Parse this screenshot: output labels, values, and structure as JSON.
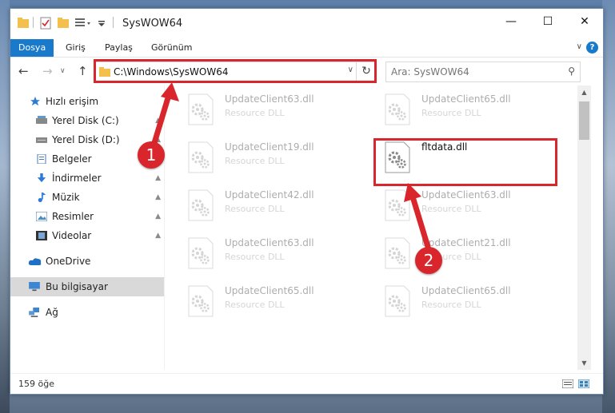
{
  "window": {
    "title": "SysWOW64",
    "controls": {
      "minimize": "—",
      "maximize": "☐",
      "close": "✕"
    }
  },
  "ribbon": {
    "tabs": [
      {
        "label": "Dosya",
        "active": true
      },
      {
        "label": "Giriş"
      },
      {
        "label": "Paylaş"
      },
      {
        "label": "Görünüm"
      }
    ],
    "help": "?"
  },
  "nav": {
    "back_icon": "arrow-left-icon",
    "forward_icon": "arrow-right-icon",
    "up_icon": "arrow-up-icon",
    "address_path": "C:\\Windows\\SysWOW64",
    "search_placeholder": "Ara: SysWOW64"
  },
  "sidebar": {
    "items": [
      {
        "label": "Hızlı erişim",
        "icon": "star-icon",
        "pinned": false
      },
      {
        "label": "Yerel Disk (C:)",
        "icon": "drive-icon",
        "pinned": true
      },
      {
        "label": "Yerel Disk (D:)",
        "icon": "drive-icon",
        "pinned": true
      },
      {
        "label": "Belgeler",
        "icon": "documents-icon",
        "pinned": true
      },
      {
        "label": "İndirmeler",
        "icon": "download-icon",
        "pinned": true
      },
      {
        "label": "Müzik",
        "icon": "music-icon",
        "pinned": true
      },
      {
        "label": "Resimler",
        "icon": "pictures-icon",
        "pinned": true
      },
      {
        "label": "Videolar",
        "icon": "videos-icon",
        "pinned": true
      },
      {
        "label": "OneDrive",
        "icon": "cloud-icon",
        "pinned": false
      },
      {
        "label": "Bu bilgisayar",
        "icon": "computer-icon",
        "pinned": false,
        "selected": true
      },
      {
        "label": "Ağ",
        "icon": "network-icon",
        "pinned": false
      }
    ]
  },
  "files": [
    {
      "name": "UpdateClient63.dll",
      "type": "Resource DLL",
      "faded": true
    },
    {
      "name": "UpdateClient65.dll",
      "type": "Resource DLL",
      "faded": true
    },
    {
      "name": "UpdateClient19.dll",
      "type": "Resource DLL",
      "faded": true
    },
    {
      "name": "fltdata.dll",
      "type": "",
      "faded": false
    },
    {
      "name": "UpdateClient42.dll",
      "type": "Resource DLL",
      "faded": true
    },
    {
      "name": "UpdateClient63.dll",
      "type": "Resource DLL",
      "faded": true
    },
    {
      "name": "UpdateClient63.dll",
      "type": "Resource DLL",
      "faded": true
    },
    {
      "name": "UpdateClient21.dll",
      "type": "Resource DLL",
      "faded": true
    },
    {
      "name": "UpdateClient65.dll",
      "type": "Resource DLL",
      "faded": true
    },
    {
      "name": "UpdateClient65.dll",
      "type": "Resource DLL",
      "faded": true
    }
  ],
  "status": {
    "count": "159 öğe"
  },
  "annotations": {
    "step1": "1",
    "step2": "2",
    "color": "#d9262c"
  }
}
